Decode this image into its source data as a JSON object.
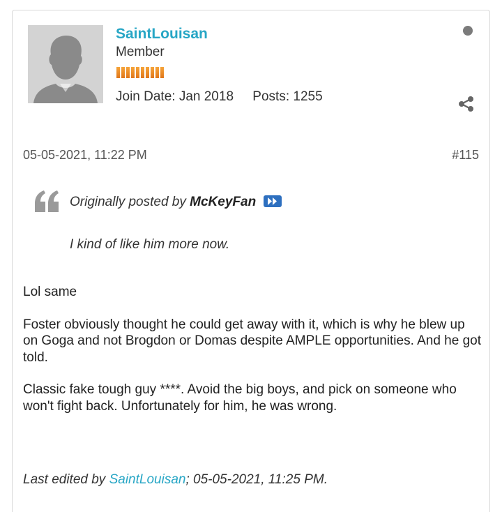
{
  "user": {
    "name": "SaintLouisan",
    "rank": "Member",
    "join_date": "Join Date: Jan 2018",
    "posts": "Posts: 1255",
    "reputation_bars": 10
  },
  "post": {
    "timestamp": "05-05-2021, 11:22 PM",
    "number": "#115",
    "quote": {
      "prefix": "Originally posted by",
      "author": "McKeyFan",
      "text": "I kind of like him more now."
    },
    "paragraphs": [
      "Lol same",
      "Foster obviously thought he could get away with it, which is why he blew up on Goga and not Brogdon or Domas despite AMPLE opportunities. And he got told.",
      "Classic fake tough guy ****. Avoid the big boys, and pick on someone who won't fight back. Unfortunately for him, he was wrong."
    ],
    "edited": {
      "prefix": "Last edited by",
      "editor": "SaintLouisan",
      "suffix": "; 05-05-2021, 11:25 PM."
    }
  },
  "colors": {
    "username": "#27a6c5",
    "reputation": "#e88a26",
    "jump_icon": "#2d6fbf",
    "status_dot": "#7b7b7b"
  },
  "icons": [
    "default-avatar-icon",
    "status-dot-icon",
    "share-icon",
    "quote-icon",
    "jump-to-post-icon"
  ]
}
